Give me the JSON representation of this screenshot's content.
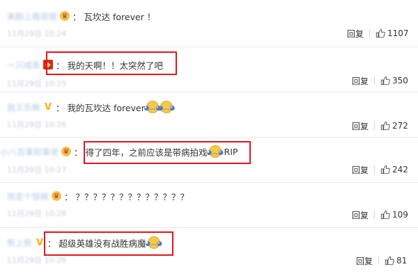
{
  "comments": [
    {
      "username": "美剧上瘾是猹",
      "badge": "crown",
      "separator": "：",
      "text": "瓦坎达 forever ！",
      "emojis": [],
      "time": "11月29日 10:24",
      "reply_label": "回复",
      "likes": "1107",
      "highlighted": false
    },
    {
      "username": "一只咸鱼",
      "badge": "red",
      "separator": "：",
      "text": "我的天啊！！太突然了吧",
      "emojis": [],
      "time": "11月29日 10:25",
      "reply_label": "回复",
      "likes": "350",
      "highlighted": true
    },
    {
      "username": "我王乐鲍",
      "badge": "v",
      "separator": "：",
      "text": "我的瓦坎达 forever",
      "emojis": [
        "crying-face",
        "crying-face"
      ],
      "time": "11月29日 10:26",
      "reply_label": "回复",
      "likes": "272",
      "highlighted": false
    },
    {
      "username": "小八百事和事佬",
      "badge": "crown",
      "separator": "：",
      "text": "得了四年，之前应该是带病拍戏",
      "emojis": [
        "crying-face"
      ],
      "text_after": "RIP",
      "time": "11月29日 10:27",
      "reply_label": "回复",
      "likes": "242",
      "highlighted": true
    },
    {
      "username": "放走个饭碗",
      "badge": "crown",
      "separator": "：",
      "text": "？？？？？？？？？？？？？",
      "emojis": [],
      "time": "11月29日 10:28",
      "reply_label": "回复",
      "likes": "109",
      "highlighted": false
    },
    {
      "username": "熊上熊",
      "badge": "v",
      "separator": "：",
      "text": "超级英雄没有战胜病魔",
      "emojis": [
        "crying-face"
      ],
      "time": "11月29日 10:29",
      "reply_label": "回复",
      "likes": "81",
      "highlighted": true
    }
  ],
  "colors": {
    "highlight_border": "#e0141e",
    "username": "#b5c9e3",
    "divider": "#e8e8e8"
  },
  "icons": {
    "like": "thumbs-up-icon",
    "emoji": "crying-face-icon"
  }
}
